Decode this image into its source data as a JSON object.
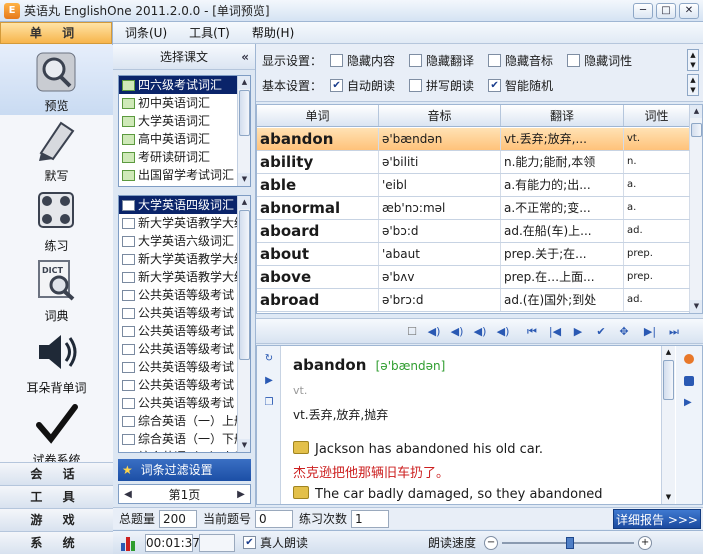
{
  "window": {
    "title": "英语丸 EnglishOne 2011.2.0.0 - [单词预览]",
    "minimize": "─",
    "maximize": "□",
    "close": "✕"
  },
  "menubar": {
    "items": [
      "词条(U)",
      "工具(T)",
      "帮助(H)"
    ]
  },
  "leftnav": {
    "active_section": "单 词",
    "tools": [
      {
        "label": "预览",
        "icon": "magnifier-icon"
      },
      {
        "label": "默写",
        "icon": "pen-icon"
      },
      {
        "label": "练习",
        "icon": "practice-icon"
      },
      {
        "label": "词典",
        "icon": "dictionary-icon"
      },
      {
        "label": "耳朵背单词",
        "icon": "speaker-icon"
      },
      {
        "label": "试卷系统",
        "icon": "checkmark-icon"
      }
    ],
    "sections": [
      "会 话",
      "工 具",
      "游 戏",
      "系 统"
    ]
  },
  "lesson_panel": {
    "title": "选择课文",
    "collapse": "«",
    "categories": [
      {
        "label": "四六级考试词汇",
        "selected": true
      },
      {
        "label": "初中英语词汇",
        "selected": false
      },
      {
        "label": "大学英语词汇",
        "selected": false
      },
      {
        "label": "高中英语词汇",
        "selected": false
      },
      {
        "label": "考研读研词汇",
        "selected": false
      },
      {
        "label": "出国留学考试词汇",
        "selected": false
      }
    ],
    "books": [
      {
        "label": "大学英语四级词汇",
        "selected": true
      },
      {
        "label": "新大学英语教学大纲",
        "selected": false
      },
      {
        "label": "大学英语六级词汇",
        "selected": false
      },
      {
        "label": "新大学英语教学大纲",
        "selected": false
      },
      {
        "label": "新大学英语教学大纲",
        "selected": false
      },
      {
        "label": "公共英语等级考试",
        "selected": false
      },
      {
        "label": "公共英语等级考试",
        "selected": false
      },
      {
        "label": "公共英语等级考试",
        "selected": false
      },
      {
        "label": "公共英语等级考试",
        "selected": false
      },
      {
        "label": "公共英语等级考试",
        "selected": false
      },
      {
        "label": "公共英语等级考试",
        "selected": false
      },
      {
        "label": "公共英语等级考试",
        "selected": false
      },
      {
        "label": "综合英语（一）上册",
        "selected": false
      },
      {
        "label": "综合英语（一）下册",
        "selected": false
      },
      {
        "label": "综合英语（二）上册",
        "selected": false
      }
    ],
    "filter_label": "词条过滤设置",
    "page_label": "第1页"
  },
  "settings": {
    "display_label": "显示设置：",
    "display_options": [
      {
        "label": "隐藏内容",
        "checked": false
      },
      {
        "label": "隐藏翻译",
        "checked": false
      },
      {
        "label": "隐藏音标",
        "checked": false
      },
      {
        "label": "隐藏词性",
        "checked": false
      }
    ],
    "basic_label": "基本设置：",
    "basic_options": [
      {
        "label": "自动朗读",
        "checked": true
      },
      {
        "label": "拼写朗读",
        "checked": false
      },
      {
        "label": "智能随机",
        "checked": true
      }
    ]
  },
  "word_table": {
    "headers": [
      "单词",
      "音标",
      "翻译",
      "词性"
    ],
    "rows": [
      {
        "word": "abandon",
        "phonetic": "ə'bændən",
        "translation": "vt.丢弃;放弃,...",
        "pos": "vt.",
        "selected": true
      },
      {
        "word": "ability",
        "phonetic": "ə'biliti",
        "translation": "n.能力;能耐,本领",
        "pos": "n.",
        "selected": false
      },
      {
        "word": "able",
        "phonetic": "'eibl",
        "translation": "a.有能力的;出...",
        "pos": "a.",
        "selected": false
      },
      {
        "word": "abnormal",
        "phonetic": "æb'nɔ:məl",
        "translation": "a.不正常的;变...",
        "pos": "a.",
        "selected": false
      },
      {
        "word": "aboard",
        "phonetic": "ə'bɔ:d",
        "translation": "ad.在船(车)上...",
        "pos": "ad.",
        "selected": false
      },
      {
        "word": "about",
        "phonetic": "'abaut",
        "translation": "prep.关于;在...",
        "pos": "prep.",
        "selected": false
      },
      {
        "word": "above",
        "phonetic": "ə'bʌv",
        "translation": "prep.在…上面...",
        "pos": "prep.",
        "selected": false
      },
      {
        "word": "abroad",
        "phonetic": "ə'brɔ:d",
        "translation": "ad.(在)国外;到处",
        "pos": "ad.",
        "selected": false
      }
    ]
  },
  "detail": {
    "word": "abandon",
    "phonetic": "[ə'bændən]",
    "pos": "vt.",
    "definition": "vt.丢弃,放弃,抛弃",
    "example1_en": "Jackson has abandoned his old car.",
    "example1_zh": "杰克逊把他那辆旧车扔了。",
    "example2_en": "The car badly damaged, so they abandoned"
  },
  "stats": {
    "total_label": "总题量",
    "total_value": "200",
    "current_label": "当前题号",
    "current_value": "0",
    "practice_label": "练习次数",
    "practice_value": "1",
    "report_button": "详细报告 >>>"
  },
  "statusbar": {
    "time": "00:01:37",
    "real_reading_label": "真人朗读",
    "real_reading_checked": true,
    "speed_label": "朗读速度",
    "speed_level": 0.5
  },
  "colors": {
    "accent": "#f7b54c",
    "selection": "#0a246a",
    "report_button": "#1b4a9f",
    "example_zh": "#cc1f1f",
    "phonetic": "#2f9d2f"
  }
}
